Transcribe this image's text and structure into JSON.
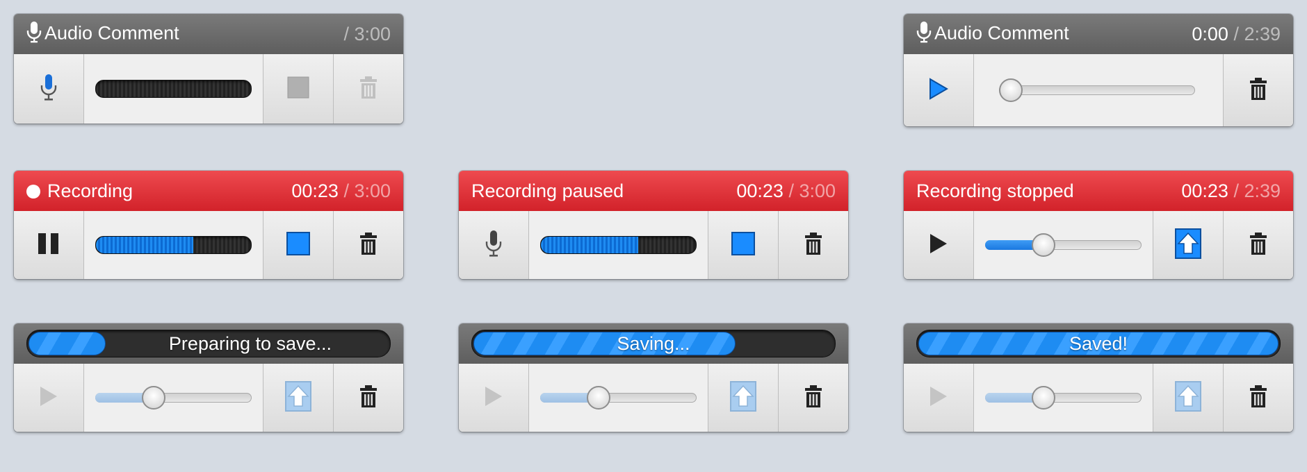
{
  "colors": {
    "background": "#d5dbe3",
    "header_gray": "#6c6c6c",
    "header_red": "#e1353c",
    "accent_blue": "#1a8cff"
  },
  "widgets": {
    "idle": {
      "title": "Audio Comment",
      "time_current": "",
      "time_total": "/ 3:00",
      "icons": [
        "mic-icon",
        "stop-icon",
        "trash-icon"
      ]
    },
    "playback": {
      "title": "Audio Comment",
      "time_current": "0:00",
      "time_total": "/ 2:39",
      "position_fraction": 0.0,
      "icons": [
        "play-icon",
        "trash-icon"
      ]
    },
    "recording": {
      "title": "Recording",
      "time_current": "00:23",
      "time_total": "/ 3:00",
      "level_fraction": 0.63,
      "icons": [
        "pause-icon",
        "stop-icon",
        "trash-icon"
      ]
    },
    "paused": {
      "title": "Recording paused",
      "time_current": "00:23",
      "time_total": "/ 3:00",
      "level_fraction": 0.63,
      "icons": [
        "mic-icon",
        "stop-icon",
        "trash-icon"
      ]
    },
    "stopped": {
      "title": "Recording stopped",
      "time_current": "00:23",
      "time_total": "/ 2:39",
      "position_fraction": 0.35,
      "icons": [
        "play-icon",
        "upload-icon",
        "trash-icon"
      ]
    },
    "preparing": {
      "status": "Preparing to save...",
      "progress_fraction": 0.22,
      "position_fraction": 0.35,
      "icons": [
        "play-icon",
        "upload-icon",
        "trash-icon"
      ]
    },
    "saving": {
      "status": "Saving...",
      "progress_fraction": 0.73,
      "position_fraction": 0.35,
      "icons": [
        "play-icon",
        "upload-icon",
        "trash-icon"
      ]
    },
    "saved": {
      "status": "Saved!",
      "progress_fraction": 1.0,
      "position_fraction": 0.35,
      "icons": [
        "play-icon",
        "upload-icon",
        "trash-icon"
      ]
    }
  }
}
